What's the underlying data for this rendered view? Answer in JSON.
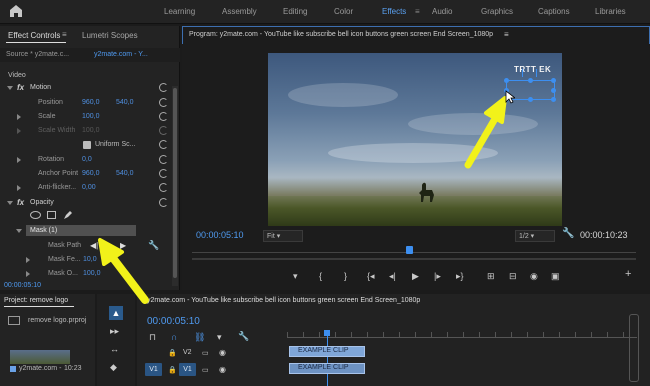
{
  "workspaces": [
    "Learning",
    "Assembly",
    "Editing",
    "Color",
    "Effects",
    "Audio",
    "Graphics",
    "Captions",
    "Libraries"
  ],
  "active_workspace": "Effects",
  "effect_controls": {
    "tab_label": "Effect Controls",
    "lumetri_tab": "Lumetri Scopes",
    "source_label": "Source * y2mate.c...",
    "sequence_label": "y2mate.com - Y...",
    "video_label": "Video",
    "motion": "Motion",
    "position_label": "Position",
    "position_x": "960,0",
    "position_y": "540,0",
    "scale_label": "Scale",
    "scale_value": "100,0",
    "scale_width_label": "Scale Width",
    "scale_width_value": "100,0",
    "uniform_label": "Uniform Sc...",
    "rotation_label": "Rotation",
    "rotation_value": "0,0",
    "anchor_label": "Anchor Point",
    "anchor_x": "960,0",
    "anchor_y": "540,0",
    "antiflicker_label": "Anti-flicker...",
    "antiflicker_value": "0,00",
    "opacity": "Opacity",
    "mask_label": "Mask (1)",
    "mask_path": "Mask Path",
    "mask_feather": "Mask Fe...",
    "mask_feather_value": "10,0",
    "mask_opacity": "Mask O...",
    "mask_opacity_value": "100,0",
    "timecode": "00:00:05:10"
  },
  "program": {
    "title": "Program: y2mate.com - YouTube like subscribe bell icon buttons green screen End Screen_1080p",
    "timecode_left": "00:00:05:10",
    "fit": "Fit",
    "resolution": "1/2",
    "timecode_right": "00:00:10:23",
    "overlay_text": "TRTT EK"
  },
  "project": {
    "title": "Project: remove logo",
    "file": "remove logo.prproj",
    "clip_name": "y2mate.com -",
    "clip_duration": "10:23"
  },
  "timeline": {
    "title": "y2mate.com - YouTube like subscribe bell icon buttons green screen End Screen_1080p",
    "timecode": "00:00:05:10",
    "tracks": [
      "V2",
      "V1"
    ],
    "clip_label": "EXAMPLE CLIP"
  },
  "colors": {
    "accent": "#4f9af0",
    "arrow": "#f2f21a"
  }
}
